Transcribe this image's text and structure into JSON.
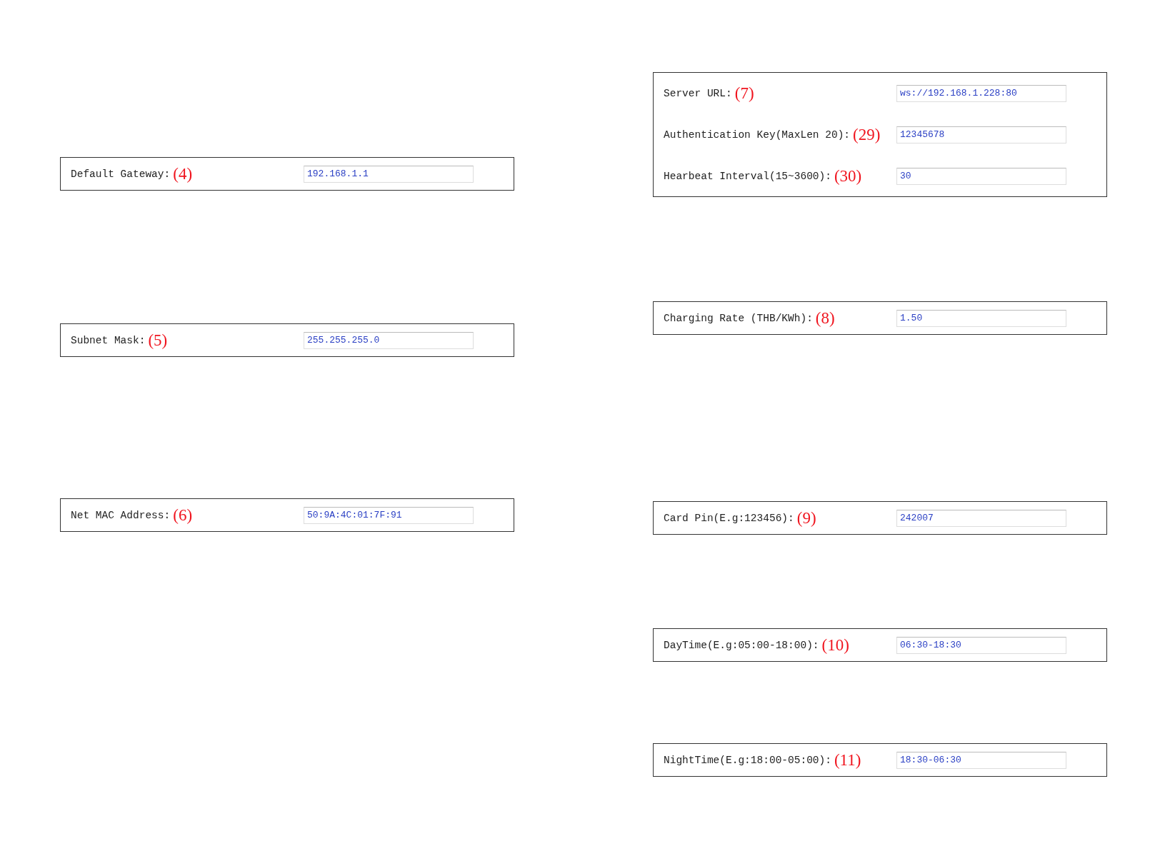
{
  "left_column": [
    {
      "rows": [
        {
          "label": "Default Gateway:",
          "marker": "(4)",
          "value": "192.168.1.1"
        }
      ]
    },
    {
      "rows": [
        {
          "label": "Subnet Mask:",
          "marker": "(5)",
          "value": "255.255.255.0"
        }
      ]
    },
    {
      "rows": [
        {
          "label": "Net MAC Address:",
          "marker": "(6)",
          "value": "50:9A:4C:01:7F:91"
        }
      ]
    }
  ],
  "right_column": [
    {
      "rows": [
        {
          "label": "Server URL:",
          "marker": "(7)",
          "value": "ws://192.168.1.228:80"
        },
        {
          "label": "Authentication Key(MaxLen 20):",
          "marker": "(29)",
          "value": "12345678"
        },
        {
          "label": "Hearbeat Interval(15~3600):",
          "marker": "(30)",
          "value": "30"
        }
      ]
    },
    {
      "rows": [
        {
          "label": "Charging Rate (THB/KWh):",
          "marker": "(8)",
          "value": "1.50"
        }
      ]
    },
    {
      "rows": [
        {
          "label": "Card Pin(E.g:123456):",
          "marker": "(9)",
          "value": "242007"
        }
      ]
    },
    {
      "rows": [
        {
          "label": "DayTime(E.g:05:00-18:00):",
          "marker": "(10)",
          "value": "06:30-18:30"
        }
      ]
    },
    {
      "rows": [
        {
          "label": "NightTime(E.g:18:00-05:00):",
          "marker": "(11)",
          "value": "18:30-06:30"
        }
      ]
    }
  ]
}
